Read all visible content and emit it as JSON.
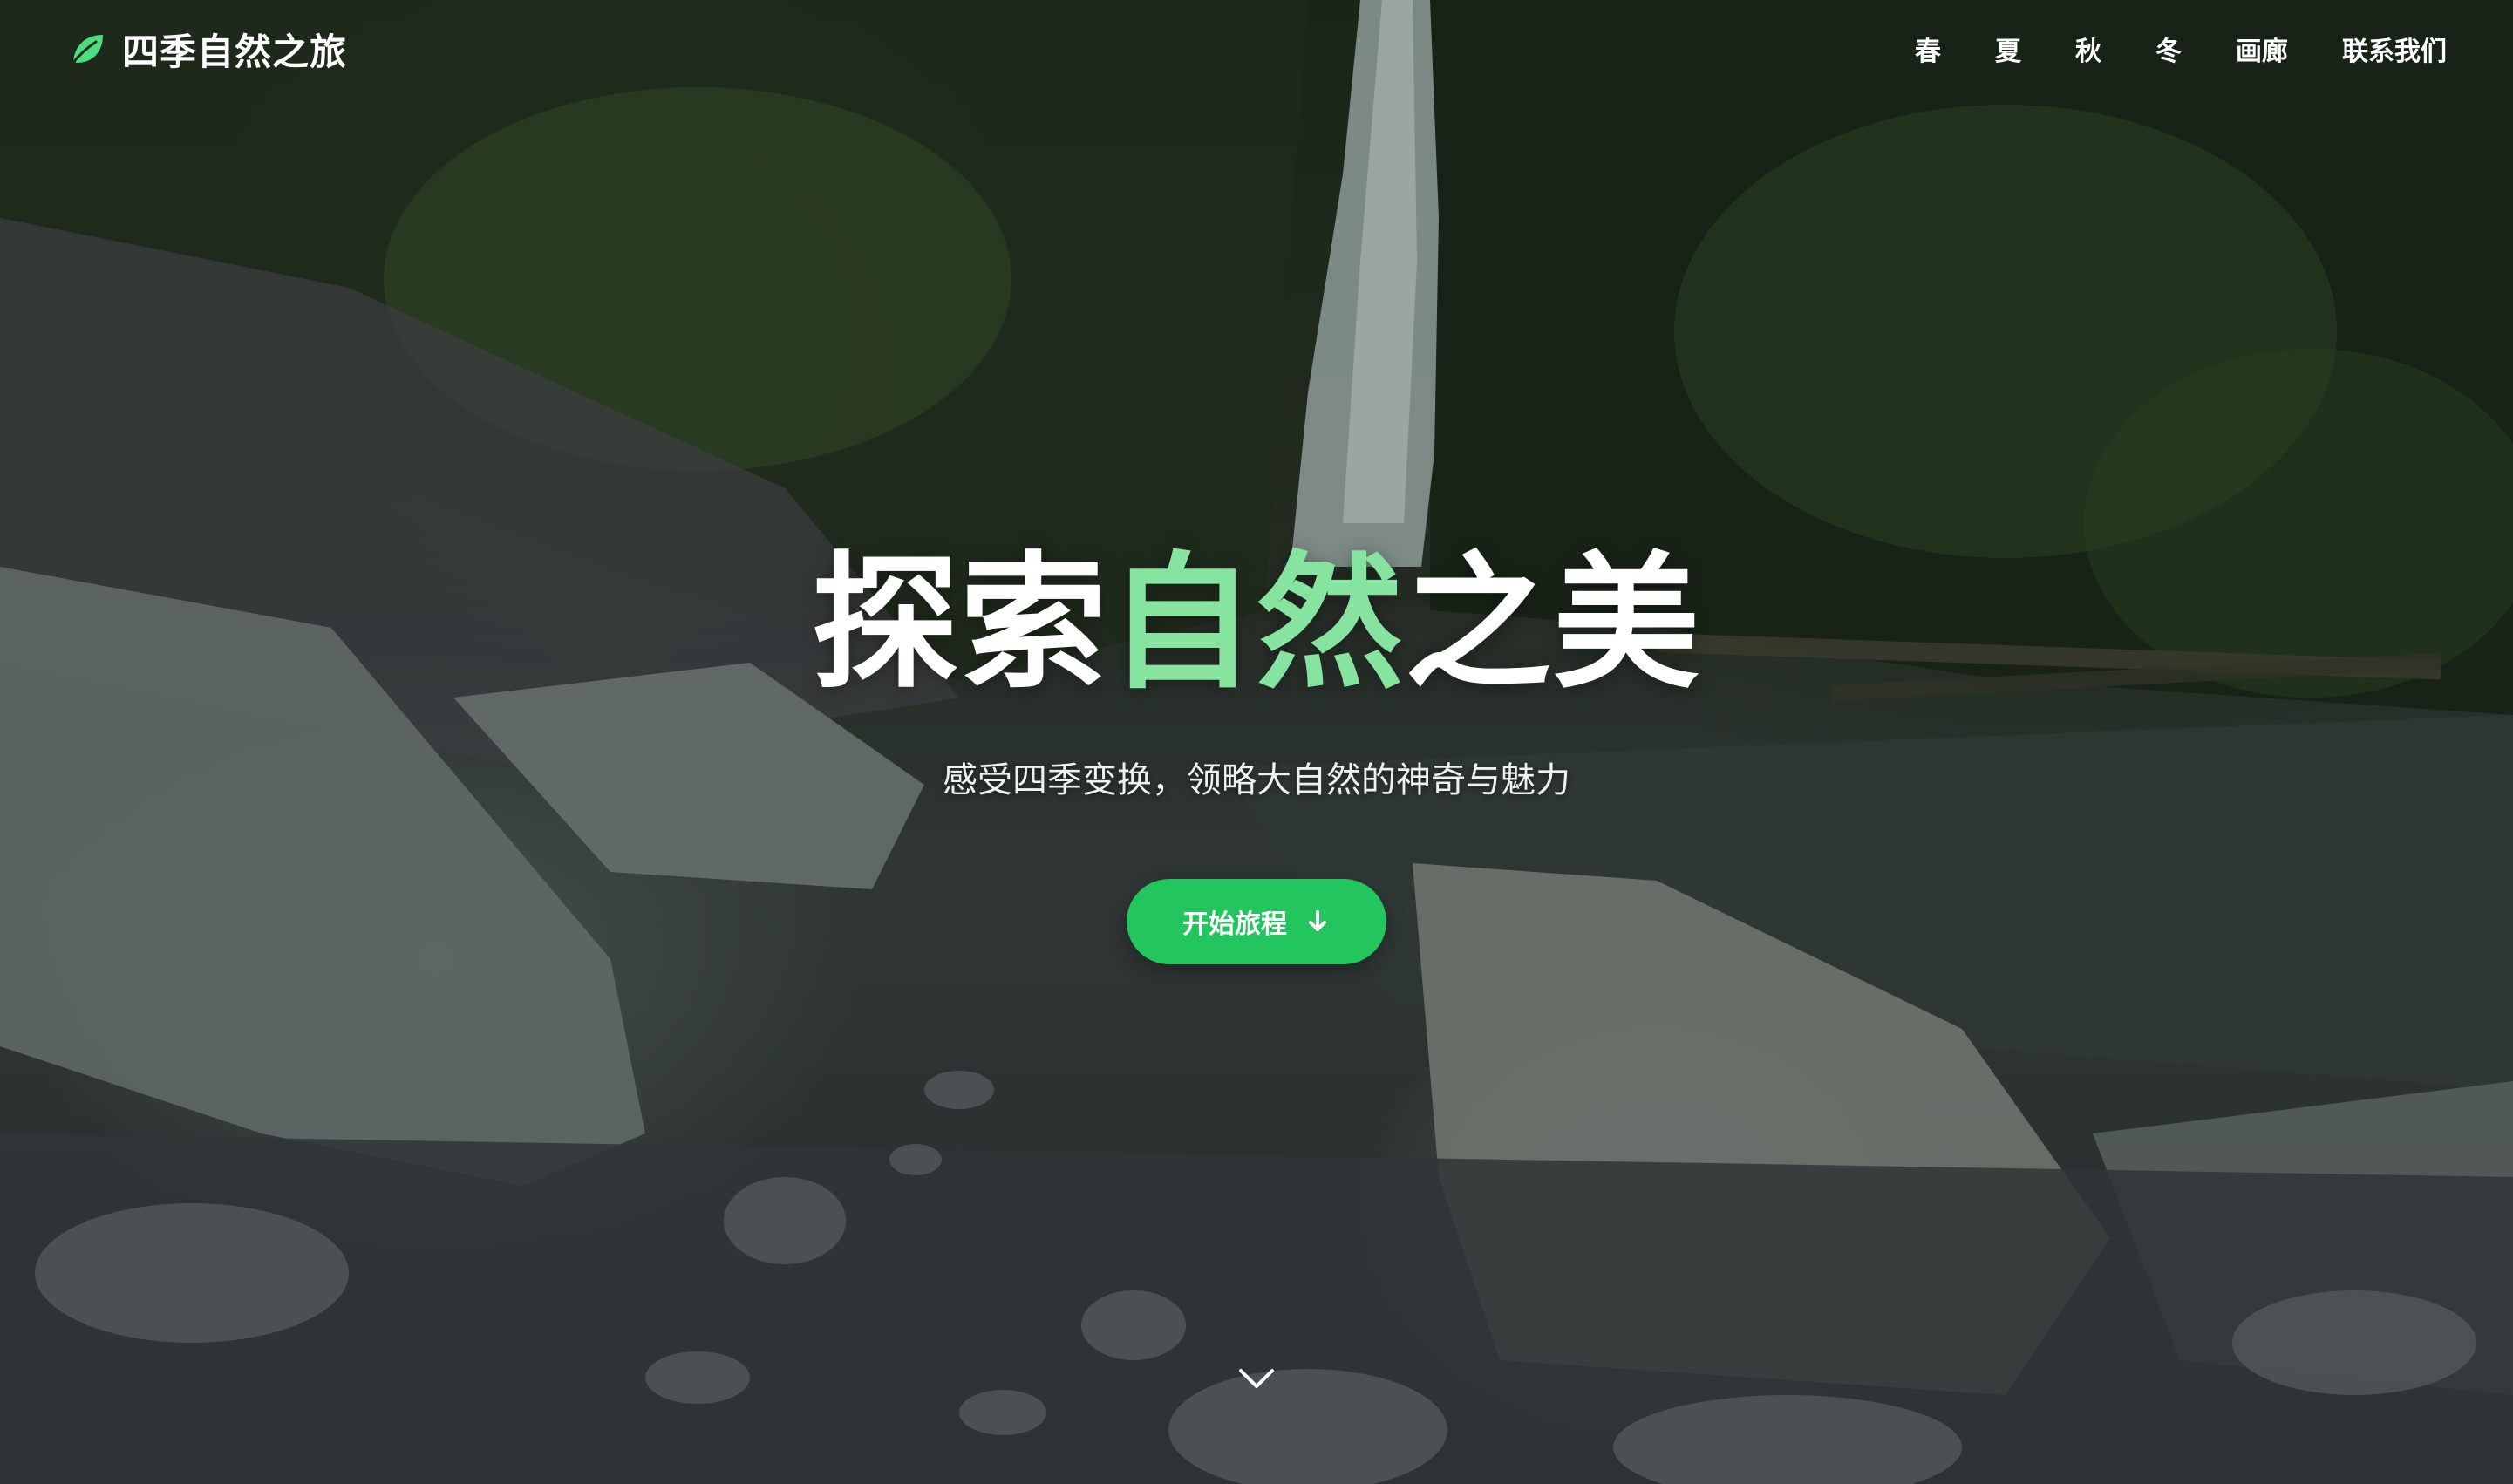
{
  "brand": {
    "name": "四季自然之旅",
    "icon": "leaf-icon",
    "accent_color": "#4ade80"
  },
  "nav": {
    "items": [
      {
        "label": "春"
      },
      {
        "label": "夏"
      },
      {
        "label": "秋"
      },
      {
        "label": "冬"
      },
      {
        "label": "画廊"
      },
      {
        "label": "联系我们"
      }
    ]
  },
  "hero": {
    "title_part1": "探索",
    "title_accent": "自然",
    "title_part2": "之美",
    "title_accent_color": "#86e3a0",
    "subtitle": "感受四季变换，领略大自然的神奇与魅力",
    "cta_label": "开始旅程",
    "cta_icon": "arrow-down-icon",
    "cta_color": "#22c55e",
    "scroll_icon": "chevron-down-icon"
  }
}
